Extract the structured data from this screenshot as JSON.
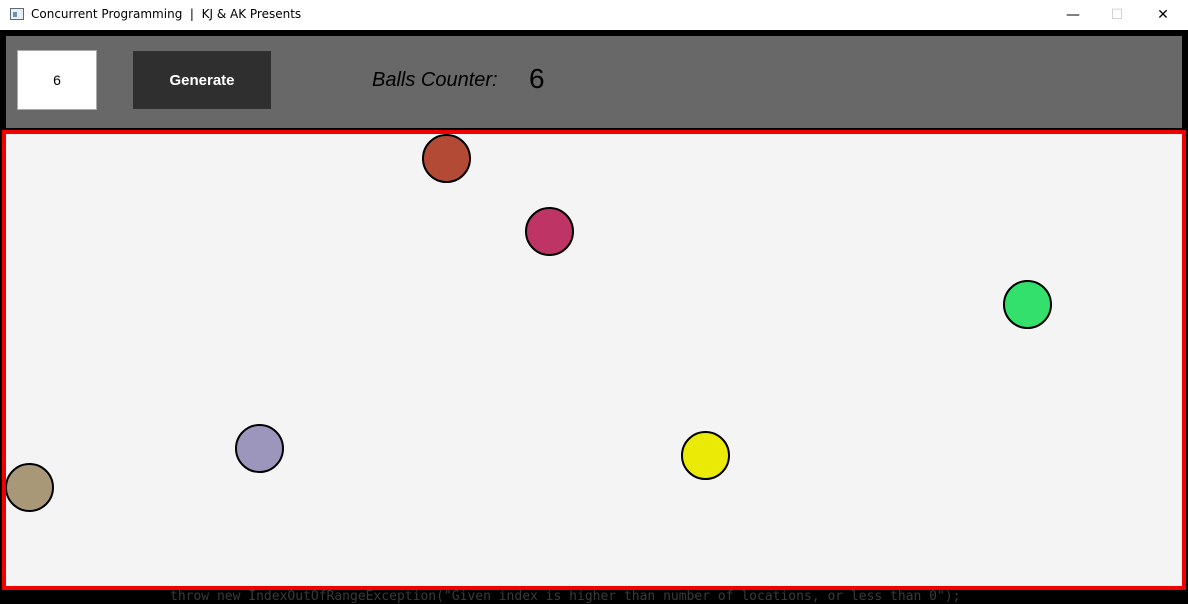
{
  "window": {
    "title": "Concurrent Programming  |  KJ & AK Presents",
    "minimize_glyph": "—",
    "maximize_glyph": "☐",
    "close_glyph": "✕"
  },
  "toolbar": {
    "ball_count_value": "6",
    "generate_label": "Generate",
    "counter_label": "Balls Counter:",
    "counter_value": "6"
  },
  "arena": {
    "border_color": "#f20000",
    "background_color": "#f4f4f4",
    "balls": [
      {
        "color": "#b34a35"
      },
      {
        "color": "#bd3465"
      },
      {
        "color": "#33e06b"
      },
      {
        "color": "#9c96bd"
      },
      {
        "color": "#a89878"
      },
      {
        "color": "#eaea06"
      }
    ]
  },
  "background_text": "throw new IndexOutOfRangeException(\"Given index is higher than number of locations, or less than 0\");"
}
